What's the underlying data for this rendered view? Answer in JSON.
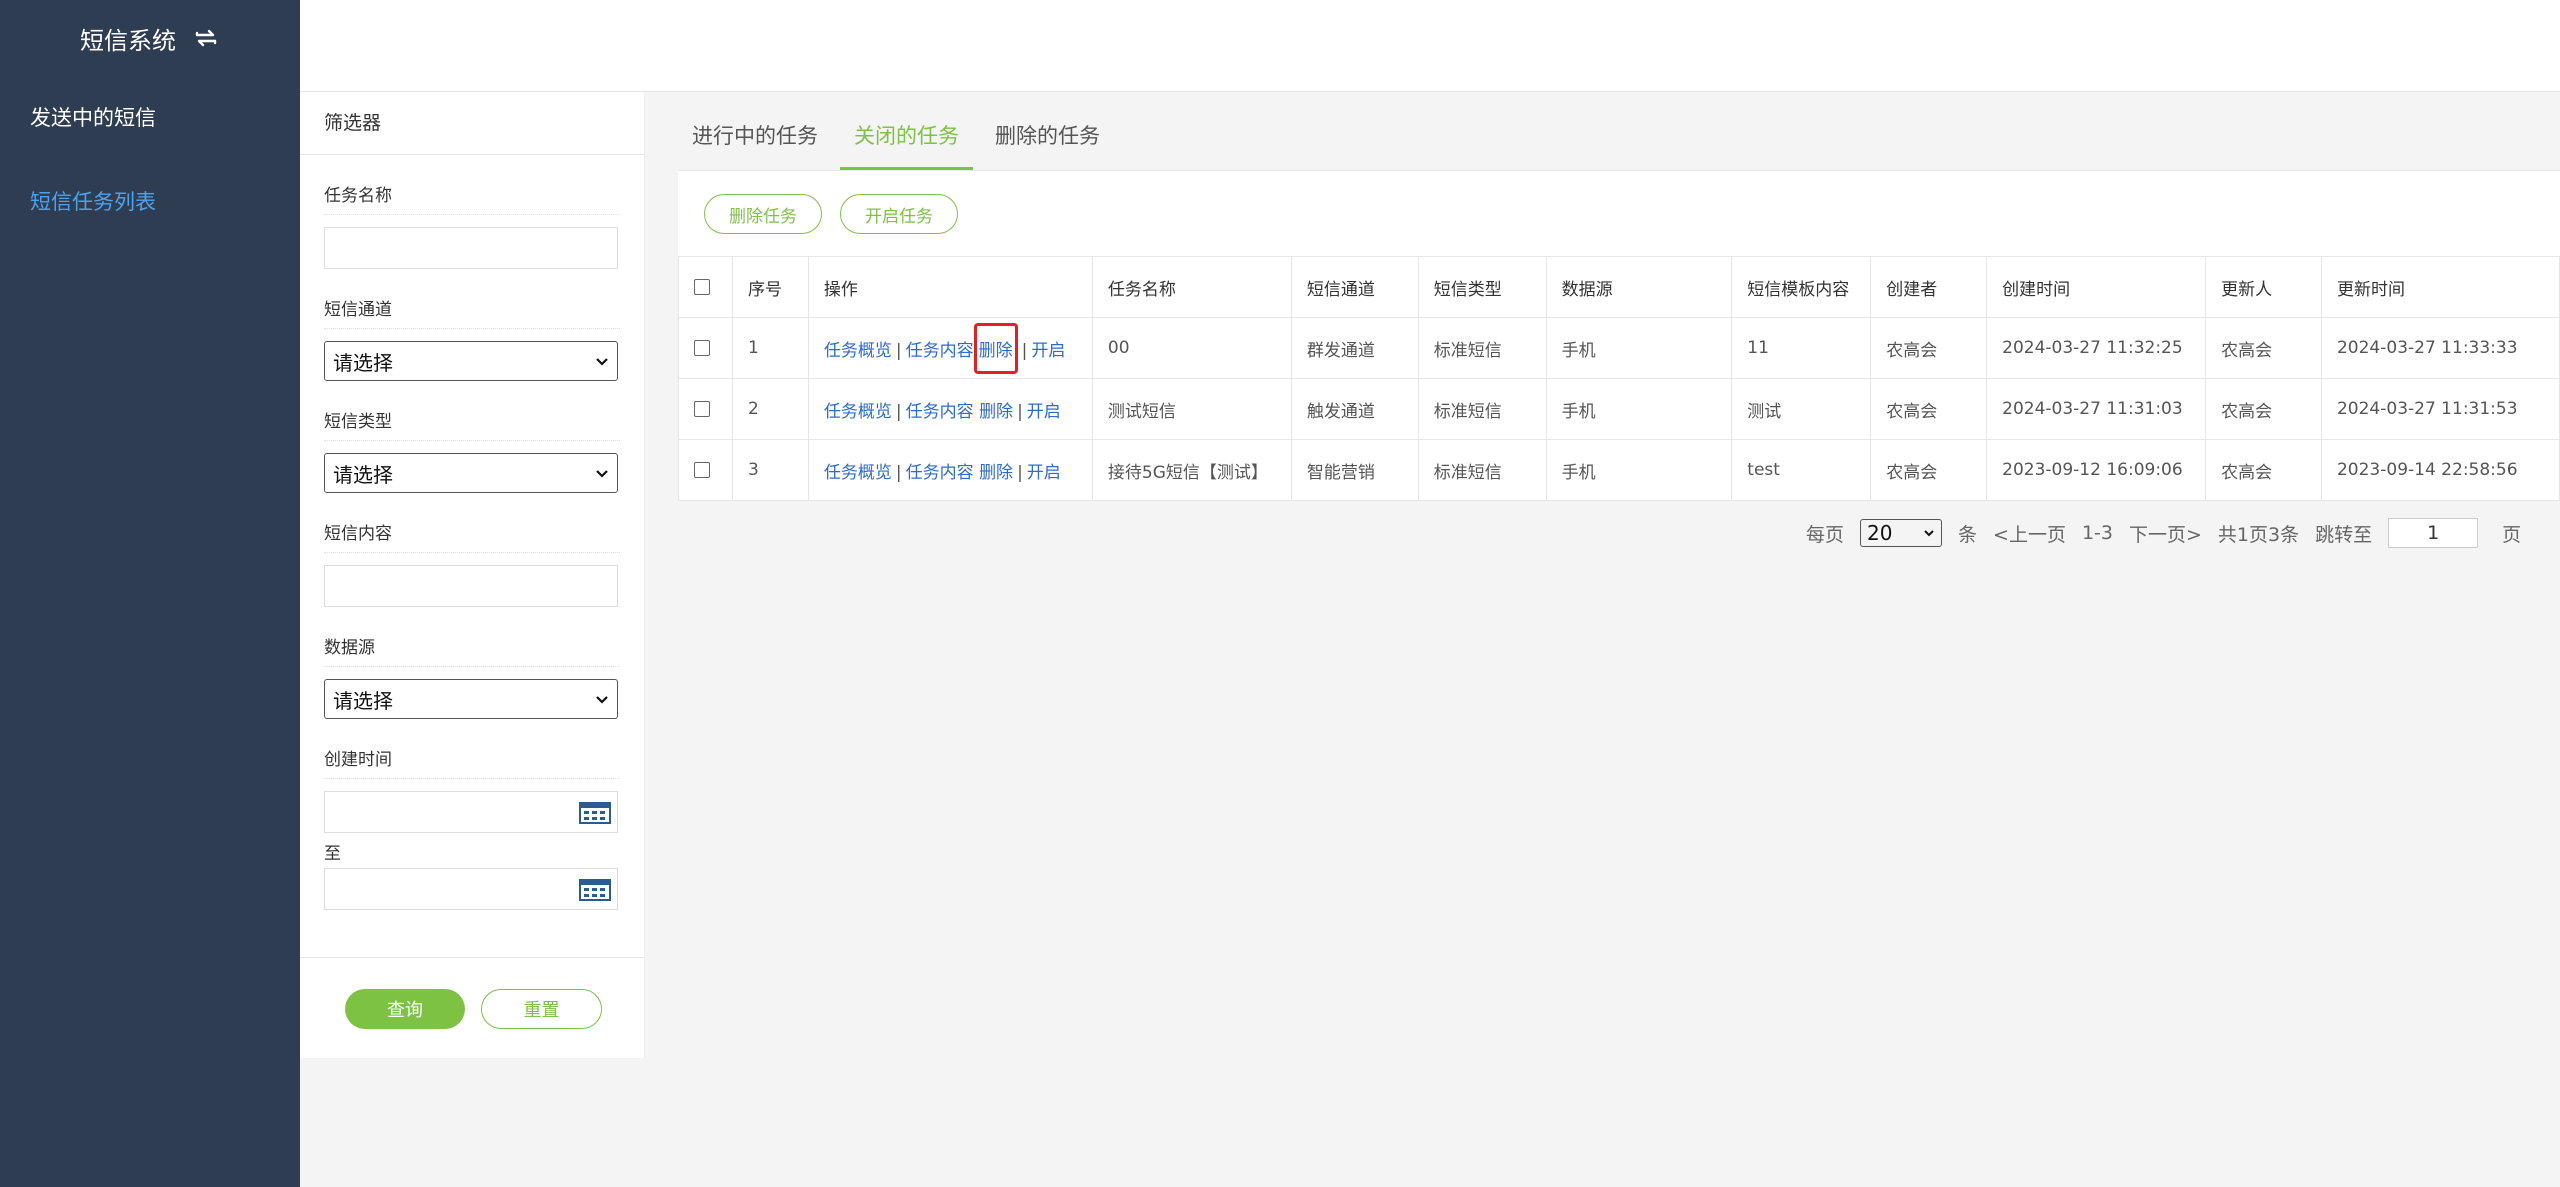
{
  "sidebar": {
    "title": "短信系统",
    "items": [
      {
        "label": "发送中的短信"
      },
      {
        "label": "短信任务列表"
      }
    ]
  },
  "filter": {
    "title": "筛选器",
    "task_name_label": "任务名称",
    "channel_label": "短信通道",
    "channel_value": "请选择",
    "type_label": "短信类型",
    "type_value": "请选择",
    "content_label": "短信内容",
    "source_label": "数据源",
    "source_value": "请选择",
    "created_label": "创建时间",
    "to_label": "至",
    "query_label": "查询",
    "reset_label": "重置"
  },
  "tabs": [
    {
      "label": "进行中的任务"
    },
    {
      "label": "关闭的任务"
    },
    {
      "label": "删除的任务"
    }
  ],
  "toolbar": {
    "delete_label": "删除任务",
    "start_label": "开启任务"
  },
  "table": {
    "headers": [
      "序号",
      "操作",
      "任务名称",
      "短信通道",
      "短信类型",
      "数据源",
      "短信模板内容",
      "创建者",
      "创建时间",
      "更新人",
      "更新时间"
    ],
    "actions": {
      "overview": "任务概览",
      "content": "任务内容",
      "delete": "删除",
      "start": "开启",
      "sep": "|"
    },
    "rows": [
      {
        "no": "1",
        "name": "00",
        "channel": "群发通道",
        "type": "标准短信",
        "source": "手机",
        "template": "11",
        "creator": "农高会",
        "created": "2024-03-27 11:32:25",
        "updater": "农高会",
        "updated": "2024-03-27 11:33:33"
      },
      {
        "no": "2",
        "name": "测试短信",
        "channel": "触发通道",
        "type": "标准短信",
        "source": "手机",
        "template": "测试",
        "creator": "农高会",
        "created": "2024-03-27 11:31:03",
        "updater": "农高会",
        "updated": "2024-03-27 11:31:53"
      },
      {
        "no": "3",
        "name": "接待5G短信【测试】",
        "channel": "智能营销",
        "type": "标准短信",
        "source": "手机",
        "template": "test",
        "creator": "农高会",
        "created": "2023-09-12 16:09:06",
        "updater": "农高会",
        "updated": "2023-09-14 22:58:56"
      }
    ]
  },
  "pager": {
    "per_page_label": "每页",
    "per_page_value": "20",
    "unit_label": "条",
    "prev_label": "<上一页",
    "range": "1-3",
    "next_label": "下一页>",
    "summary": "共1页3条",
    "jump_label": "跳转至",
    "jump_value": "1",
    "page_label": "页"
  },
  "colors": {
    "sidebar_bg": "#2f3d52",
    "accent": "#7dc243",
    "link": "#2d6bd4",
    "highlight": "#e52020"
  }
}
